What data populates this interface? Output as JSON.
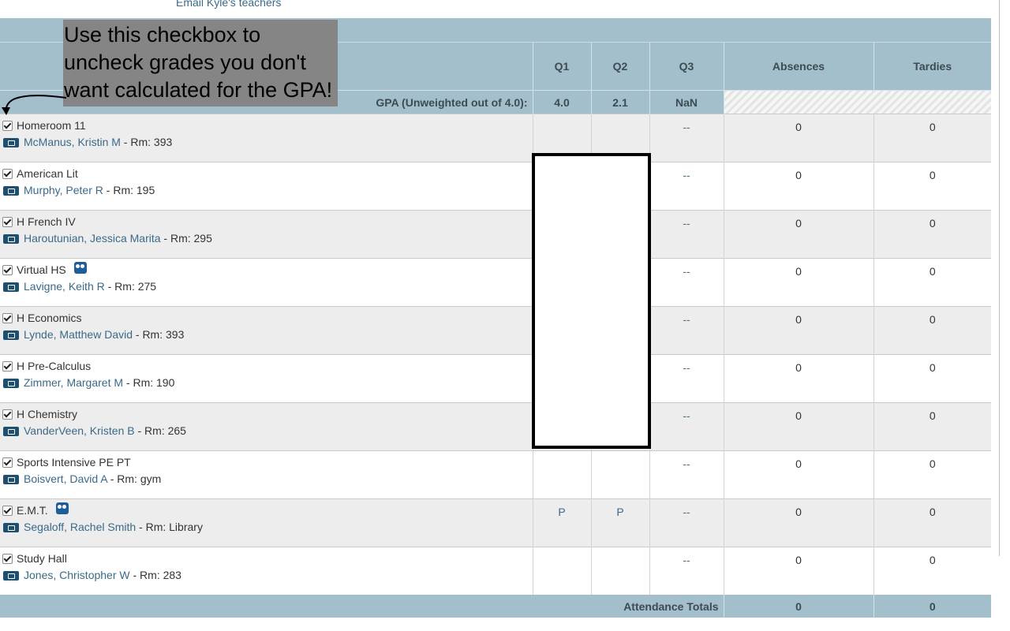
{
  "header": {
    "email_link": "Email Kyle's teachers"
  },
  "annotation": {
    "callout_text": "Use this checkbox to uncheck grades you don't want calculated for the GPA!"
  },
  "table": {
    "columns": {
      "q1": "Q1",
      "q2": "Q2",
      "q3": "Q3",
      "absences": "Absences",
      "tardies": "Tardies"
    },
    "gpa": {
      "label": "GPA (Unweighted out of 4.0):",
      "q1": "4.0",
      "q2": "2.1",
      "q3": "NaN"
    },
    "rows": [
      {
        "course": "Homeroom 11",
        "teacher": "McManus, Kristin M",
        "room": " - Rm: 393",
        "q1": "",
        "q2": "",
        "q3": "--",
        "absences": "0",
        "tardies": "0"
      },
      {
        "course": "American Lit",
        "teacher": "Murphy, Peter R",
        "room": " - Rm: 195",
        "q1": "",
        "q2": "",
        "q3": "--",
        "absences": "0",
        "tardies": "0"
      },
      {
        "course": "H French IV",
        "teacher": "Haroutunian, Jessica Marita",
        "room": " - Rm: 295",
        "q1": "",
        "q2": "",
        "q3": "--",
        "absences": "0",
        "tardies": "0"
      },
      {
        "course": "Virtual HS",
        "teacher": "Lavigne, Keith R",
        "room": " - Rm: 275",
        "q1": "",
        "q2": "",
        "q3": "--",
        "absences": "0",
        "tardies": "0"
      },
      {
        "course": "H Economics",
        "teacher": "Lynde, Matthew David",
        "room": " - Rm: 393",
        "q1": "",
        "q2": "",
        "q3": "--",
        "absences": "0",
        "tardies": "0"
      },
      {
        "course": "H Pre-Calculus",
        "teacher": "Zimmer, Margaret M",
        "room": " - Rm: 190",
        "q1": "",
        "q2": "",
        "q3": "--",
        "absences": "0",
        "tardies": "0"
      },
      {
        "course": "H Chemistry",
        "teacher": "VanderVeen, Kristen B",
        "room": " - Rm: 265",
        "q1": "",
        "q2": "",
        "q3": "--",
        "absences": "0",
        "tardies": "0"
      },
      {
        "course": "Sports Intensive PE PT",
        "teacher": "Boisvert, David A",
        "room": " - Rm: gym",
        "q1": "",
        "q2": "",
        "q3": "--",
        "absences": "0",
        "tardies": "0"
      },
      {
        "course": "E.M.T.",
        "teacher": "Segaloff, Rachel Smith",
        "room": " - Rm: Library",
        "q1": "P",
        "q2": "P",
        "q3": "--",
        "absences": "0",
        "tardies": "0"
      },
      {
        "course": "Study Hall",
        "teacher": "Jones, Christopher W",
        "room": " - Rm: 283",
        "q1": "",
        "q2": "",
        "q3": "--",
        "absences": "0",
        "tardies": "0"
      }
    ],
    "totals": {
      "label": "Attendance Totals",
      "absences": "0",
      "tardies": "0"
    }
  }
}
